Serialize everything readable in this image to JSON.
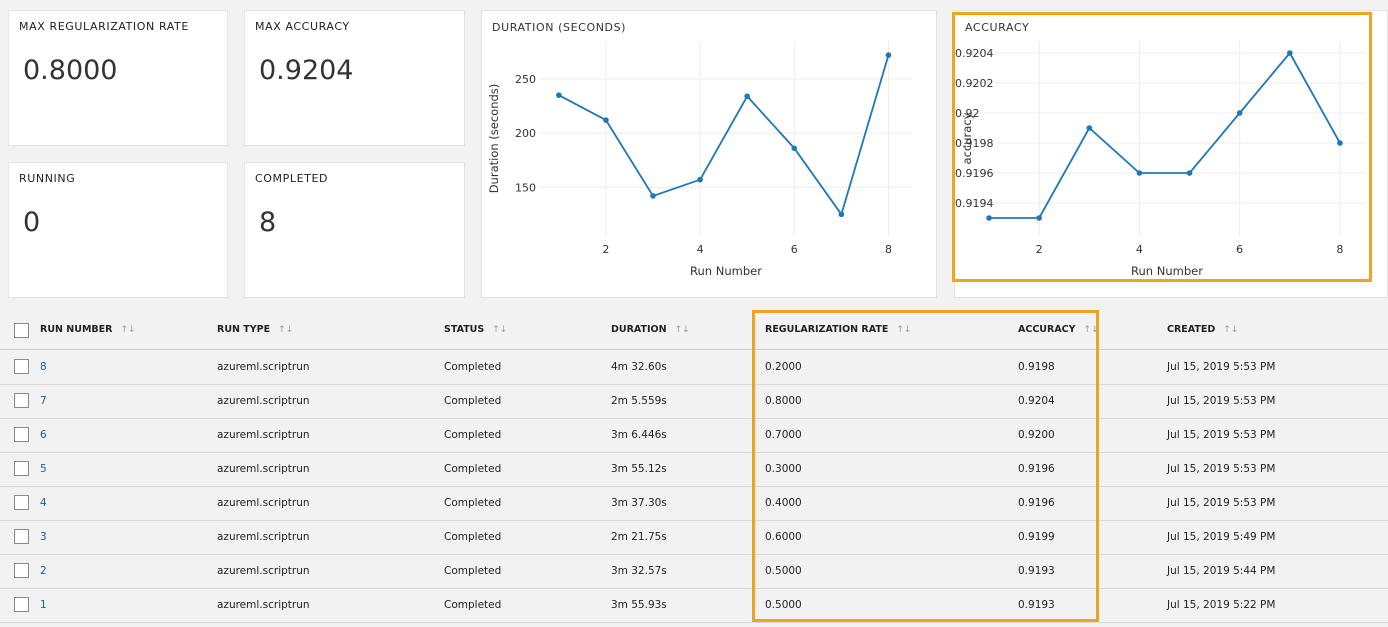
{
  "cards": {
    "max_reg_rate": {
      "title": "MAX REGULARIZATION RATE",
      "value": "0.8000"
    },
    "max_accuracy": {
      "title": "MAX ACCURACY",
      "value": "0.9204"
    },
    "running": {
      "title": "RUNNING",
      "value": "0"
    },
    "completed": {
      "title": "COMPLETED",
      "value": "8"
    }
  },
  "chart_data": [
    {
      "type": "line",
      "title": "DURATION (SECONDS)",
      "xlabel": "Run Number",
      "ylabel": "Duration (seconds)",
      "x": [
        1,
        2,
        3,
        4,
        5,
        6,
        7,
        8
      ],
      "y": [
        235,
        212,
        142,
        157,
        234,
        186,
        125,
        272
      ],
      "xticks": [
        "2",
        "4",
        "6",
        "8"
      ],
      "yticks": [
        "150",
        "200",
        "250"
      ],
      "xlim": [
        0.6,
        8.5
      ],
      "ylim": [
        105,
        285
      ],
      "grid": true,
      "color": "#1f77b4"
    },
    {
      "type": "line",
      "title": "ACCURACY",
      "xlabel": "Run Number",
      "ylabel": "accuracy",
      "x": [
        1,
        2,
        3,
        4,
        5,
        6,
        7,
        8
      ],
      "y": [
        0.9193,
        0.9193,
        0.9199,
        0.9196,
        0.9196,
        0.92,
        0.9204,
        0.9198
      ],
      "xticks": [
        "2",
        "4",
        "6",
        "8"
      ],
      "yticks": [
        "0.9194",
        "0.9196",
        "0.9198",
        "0.92",
        "0.9202",
        "0.9204"
      ],
      "xlim": [
        0.6,
        8.5
      ],
      "ylim": [
        0.91918,
        0.92048
      ],
      "grid": true,
      "color": "#1f77b4"
    }
  ],
  "table": {
    "headers": [
      "RUN NUMBER",
      "RUN TYPE",
      "STATUS",
      "DURATION",
      "REGULARIZATION RATE",
      "ACCURACY",
      "CREATED"
    ],
    "sort_icons": [
      "↑↓",
      "↑↓",
      "↑↓",
      "↑↓",
      "↑↓",
      "↑↓",
      "↑↓"
    ],
    "rows": [
      [
        "8",
        "azureml.scriptrun",
        "Completed",
        "4m 32.60s",
        "0.2000",
        "0.9198",
        "Jul 15, 2019 5:53 PM"
      ],
      [
        "7",
        "azureml.scriptrun",
        "Completed",
        "2m 5.559s",
        "0.8000",
        "0.9204",
        "Jul 15, 2019 5:53 PM"
      ],
      [
        "6",
        "azureml.scriptrun",
        "Completed",
        "3m 6.446s",
        "0.7000",
        "0.9200",
        "Jul 15, 2019 5:53 PM"
      ],
      [
        "5",
        "azureml.scriptrun",
        "Completed",
        "3m 55.12s",
        "0.3000",
        "0.9196",
        "Jul 15, 2019 5:53 PM"
      ],
      [
        "4",
        "azureml.scriptrun",
        "Completed",
        "3m 37.30s",
        "0.4000",
        "0.9196",
        "Jul 15, 2019 5:53 PM"
      ],
      [
        "3",
        "azureml.scriptrun",
        "Completed",
        "2m 21.75s",
        "0.6000",
        "0.9199",
        "Jul 15, 2019 5:49 PM"
      ],
      [
        "2",
        "azureml.scriptrun",
        "Completed",
        "3m 32.57s",
        "0.5000",
        "0.9193",
        "Jul 15, 2019 5:44 PM"
      ],
      [
        "1",
        "azureml.scriptrun",
        "Completed",
        "3m 55.93s",
        "0.5000",
        "0.9193",
        "Jul 15, 2019 5:22 PM"
      ]
    ]
  },
  "colors": {
    "highlight": "#f0a31e",
    "link": "#1a5ea8",
    "line": "#1f77b4"
  }
}
